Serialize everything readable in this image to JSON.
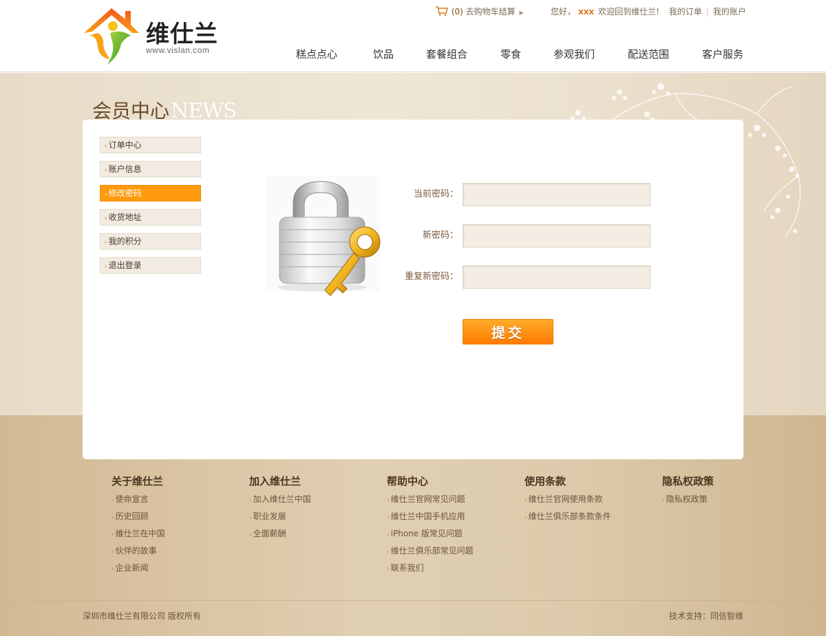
{
  "header": {
    "logo_name": "维仕兰",
    "logo_url": "www.vislan.com",
    "cart": {
      "count": "(0)",
      "label": "去购物车结算"
    },
    "welcome": {
      "greeting": "您好，",
      "user": "XXX",
      "message": "欢迎回到维仕兰!",
      "my_orders": "我的订单",
      "my_account": "我的账户"
    },
    "nav": [
      "糕点点心",
      "饮品",
      "套餐组合",
      "零食",
      "参观我们",
      "配送范围",
      "客户服务"
    ]
  },
  "section": {
    "title_cn": "会员中心",
    "title_en": "NEWS"
  },
  "sidebar": {
    "items": [
      {
        "label": "订单中心"
      },
      {
        "label": "账户信息"
      },
      {
        "label": "修改密码"
      },
      {
        "label": "收货地址"
      },
      {
        "label": "我的积分"
      },
      {
        "label": "退出登录"
      }
    ]
  },
  "form": {
    "current_password": {
      "label": "当前密码：",
      "value": ""
    },
    "new_password": {
      "label": "新密码：",
      "value": ""
    },
    "repeat_password": {
      "label": "重复新密码：",
      "value": ""
    },
    "submit_label": "提交"
  },
  "footer": {
    "columns": [
      {
        "title": "关于维仕兰",
        "links": [
          "使命宣言",
          "历史回顾",
          "维仕兰在中国",
          "伙伴的故事",
          "企业新闻"
        ]
      },
      {
        "title": "加入维仕兰",
        "links": [
          "加入维仕兰中国",
          "职业发展",
          "全面薪酬"
        ]
      },
      {
        "title": "帮助中心",
        "links": [
          "维仕兰官网常见问题",
          "维仕兰中国手机应用",
          "iPhone 版常见问题",
          "维仕兰俱乐部常见问题",
          "联系我们"
        ]
      },
      {
        "title": "使用条款",
        "links": [
          "维仕兰官网使用条款",
          "维仕兰俱乐部条款条件"
        ]
      },
      {
        "title": "隐私权政策",
        "links": [
          "隐私权政策"
        ]
      }
    ],
    "copyright": "深圳市维仕兰有限公司  版权所有",
    "support": "技术支持：同信智维"
  },
  "colors": {
    "accent": "#ff8a00",
    "brown": "#6b4a2a",
    "band": "#ece1cf",
    "footer": "#d8c3a2"
  }
}
